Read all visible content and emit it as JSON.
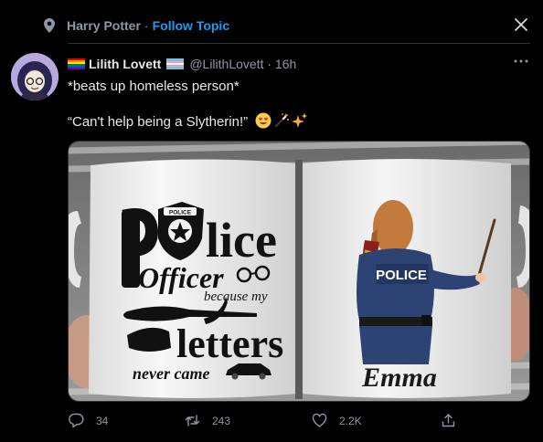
{
  "topic": {
    "name": "Harry Potter",
    "separator": "·",
    "follow_label": "Follow Topic"
  },
  "tweet": {
    "display_name": "Lilith Lovett",
    "handle": "@LilithLovett · 16h",
    "text_line1": "*beats up homeless person*",
    "text_line2": "“Can't help being a Slytherin!”"
  },
  "media": {
    "left_mug": {
      "words": [
        "p",
        "lice",
        "Officer",
        "because my",
        "letters",
        "never came"
      ],
      "badge_text": "POLICE"
    },
    "right_mug": {
      "shirt_text": "POLICE",
      "name": "Emma"
    }
  },
  "actions": {
    "replies": "34",
    "retweets": "243",
    "likes": "2.2K"
  },
  "colors": {
    "background": "#000000",
    "accent": "#1d9bf0",
    "muted": "#8b98a5",
    "text": "#e7e9ea"
  },
  "icons": [
    "location-pin-icon",
    "close-icon",
    "more-icon",
    "reply-icon",
    "retweet-icon",
    "like-icon",
    "share-icon"
  ]
}
